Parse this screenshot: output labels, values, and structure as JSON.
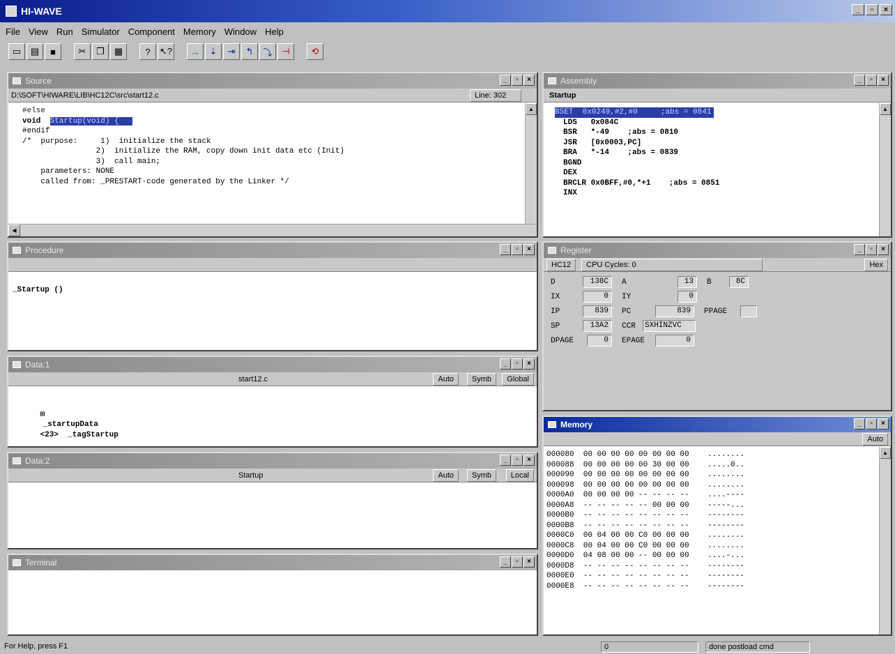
{
  "app": {
    "title": "HI-WAVE",
    "ctrl_min": "_",
    "ctrl_max": "▫",
    "ctrl_close": "×"
  },
  "menu": [
    "File",
    "View",
    "Run",
    "Simulator",
    "Component",
    "Memory",
    "Window",
    "Help"
  ],
  "toolbar": {
    "groups": [
      [
        {
          "icon": "new-icon",
          "glyph": "▭"
        },
        {
          "icon": "open-icon",
          "glyph": "▤"
        },
        {
          "icon": "save-icon",
          "glyph": "■"
        }
      ],
      [
        {
          "icon": "cut-icon",
          "glyph": "✂"
        },
        {
          "icon": "copy-icon",
          "glyph": "❐"
        },
        {
          "icon": "paste-icon",
          "glyph": "▦"
        }
      ],
      [
        {
          "icon": "help-icon",
          "glyph": "?"
        },
        {
          "icon": "context-help-icon",
          "glyph": "↖?"
        }
      ],
      [
        {
          "icon": "start-icon",
          "glyph": "→"
        },
        {
          "icon": "single-step-icon",
          "glyph": "⇣"
        },
        {
          "icon": "step-over-icon",
          "glyph": "⇥"
        },
        {
          "icon": "step-out-icon",
          "glyph": "↰"
        },
        {
          "icon": "assembly-step-icon",
          "glyph": "⤵"
        },
        {
          "icon": "halt-icon",
          "glyph": "⊣"
        }
      ],
      [
        {
          "icon": "reset-icon",
          "glyph": "⟲"
        }
      ]
    ]
  },
  "source": {
    "title": "Source",
    "path": "D:\\SOFT\\HIWARE\\LIB\\HC12C\\src\\start12.c",
    "line_info": "Line: 302",
    "lines": [
      "#else",
      "void  Startup(void) {",
      "#endif",
      "/*  purpose:     1)  initialize the stack",
      "                2)  initialize the RAM, copy down init data etc (Init)",
      "                3)  call main;",
      "    parameters: NONE",
      "    called from: _PRESTART-code generated by the Linker */"
    ],
    "highlight_text": "Startup(void) {"
  },
  "assembly": {
    "title": "Assembly",
    "label": "Startup",
    "highlighted_line": "BSET  0x0249,#2,#0     ;abs = 0841",
    "lines": [
      "LDS   0x084C",
      "BSR   *-49    ;abs = 0810",
      "JSR   [0x0003,PC]",
      "BRA   *-14    ;abs = 0839",
      "BGND",
      "DEX",
      "BRCLR 0x0BFF,#0,*+1    ;abs = 0851",
      "INX"
    ]
  },
  "procedure": {
    "title": "Procedure",
    "items": [
      "_Startup ()"
    ]
  },
  "register": {
    "title": "Register",
    "cpu": "HC12",
    "cycles": "CPU Cycles: 0",
    "format": "Hex",
    "rows": [
      [
        {
          "n": "D",
          "v": "138C"
        },
        {
          "n": "A",
          "v": "13"
        },
        {
          "n": "B",
          "v": "8C"
        }
      ],
      [
        {
          "n": "IX",
          "v": "0"
        },
        {
          "n": "IY",
          "v": "0"
        }
      ],
      [
        {
          "n": "IP",
          "v": "839"
        },
        {
          "n": "PC",
          "v": "839"
        },
        {
          "n": "PPAGE",
          "v": ""
        }
      ],
      [
        {
          "n": "SP",
          "v": "13A2"
        },
        {
          "n": "CCR",
          "v": "SXHINZVC"
        }
      ],
      [
        {
          "n": "DPAGE",
          "v": "0"
        },
        {
          "n": "EPAGE",
          "v": "0"
        }
      ]
    ]
  },
  "data1": {
    "title": "Data:1",
    "file": "start12.c",
    "mode": "Auto",
    "symb": "Symb",
    "scope": "Global",
    "rows": [
      {
        "expand": "⊞",
        "name": "_startupData",
        "value": "<23>  _tagStartup"
      }
    ]
  },
  "data2": {
    "title": "Data:2",
    "file": "Startup",
    "mode": "Auto",
    "symb": "Symb",
    "scope": "Local"
  },
  "memory": {
    "title": "Memory",
    "mode": "Auto",
    "lines": [
      "000080  00 00 00 00 00 00 00 00    ........",
      "000088  00 00 00 00 00 30 00 00    .....0..",
      "000090  00 00 00 00 00 00 00 00    ........",
      "000098  00 00 00 00 00 00 00 00    ........",
      "0000A0  00 00 00 00 -- -- -- --    ....----",
      "0000A8  -- -- -- -- -- 00 00 00    -----...",
      "0000B0  -- -- -- -- -- -- -- --    --------",
      "0000B8  -- -- -- -- -- -- -- --    --------",
      "0000C0  00 04 00 00 C0 00 00 00    ........",
      "0000C8  00 04 00 00 C0 00 00 00    ........",
      "0000D0  04 08 00 00 -- 00 00 00    ....-...",
      "0000D8  -- -- -- -- -- -- -- --    --------",
      "0000E0  -- -- -- -- -- -- -- --    --------",
      "0000E8  -- -- -- -- -- -- -- --    --------"
    ]
  },
  "terminal": {
    "title": "Terminal"
  },
  "status": {
    "help": "For Help, press F1",
    "value": "0",
    "message": "done postload cmd"
  }
}
